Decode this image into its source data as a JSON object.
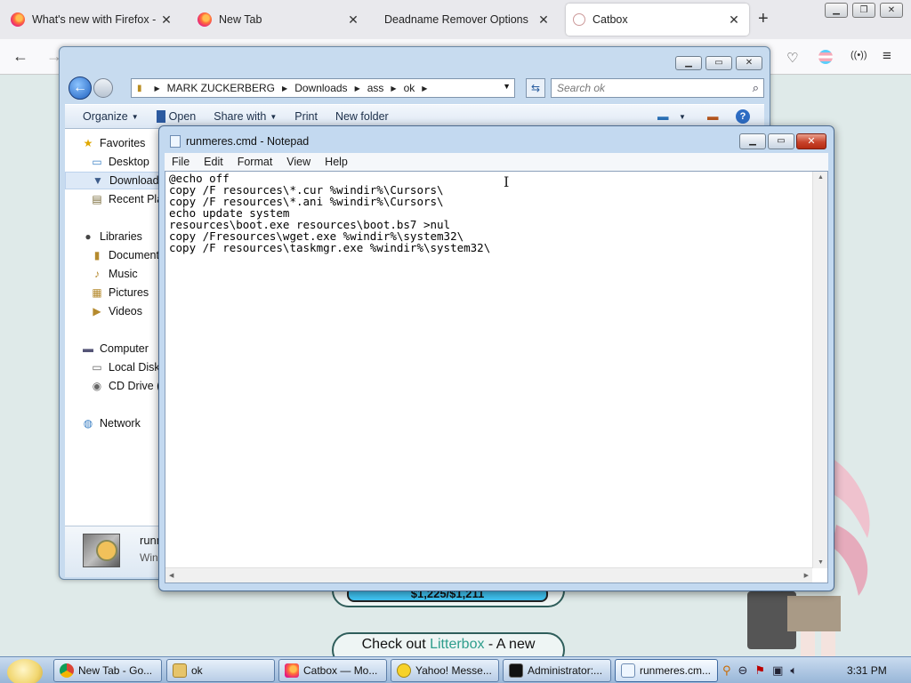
{
  "firefox": {
    "tabs": [
      {
        "title": "What's new with Firefox - Mo",
        "icon": "firefox-icon"
      },
      {
        "title": "New Tab",
        "icon": "firefox-icon"
      },
      {
        "title": "Deadname Remover Options",
        "icon": ""
      },
      {
        "title": "Catbox",
        "icon": "catbox-icon"
      }
    ],
    "new_tab_symbol": "+",
    "close_symbol": "✕",
    "window_controls": {
      "min": "▁",
      "max": "❐",
      "close": "✕"
    }
  },
  "page": {
    "price": "$1,225/$1,211",
    "litter_prefix": "Check out ",
    "litter_link": "Litterbox",
    "litter_suffix": " - A new"
  },
  "explorer": {
    "breadcrumbs": [
      "MARK ZUCKERBERG",
      "Downloads",
      "ass",
      "ok"
    ],
    "search_placeholder": "Search ok",
    "toolbar": {
      "organize": "Organize",
      "open": "Open",
      "share_with": "Share with",
      "print": "Print",
      "new_folder": "New folder"
    },
    "nav": {
      "favorites": "Favorites",
      "desktop": "Desktop",
      "downloads": "Downloads",
      "recent": "Recent Places",
      "libraries": "Libraries",
      "documents": "Documents",
      "music": "Music",
      "pictures": "Pictures",
      "videos": "Videos",
      "computer": "Computer",
      "local_disk": "Local Disk",
      "cd_drive": "CD Drive (",
      "network": "Network"
    },
    "details": {
      "name": "runmeres",
      "type": "Windows"
    }
  },
  "notepad": {
    "title": "runmeres.cmd - Notepad",
    "menus": [
      "File",
      "Edit",
      "Format",
      "View",
      "Help"
    ],
    "content": "@echo off\ncopy /F resources\\*.cur %windir%\\Cursors\\\ncopy /F resources\\*.ani %windir%\\Cursors\\\necho update system\nresources\\boot.exe resources\\boot.bs7 >nul\ncopy /Fresources\\wget.exe %windir%\\system32\\\ncopy /F resources\\taskmgr.exe %windir%\\system32\\"
  },
  "taskbar": {
    "tasks": [
      {
        "label": "New Tab - Go...",
        "icon": "chrome-icon"
      },
      {
        "label": "ok",
        "icon": "folder-icon"
      },
      {
        "label": "Catbox — Mo...",
        "icon": "firefox-icon"
      },
      {
        "label": "Yahoo! Messe...",
        "icon": "yahoo-messenger-icon"
      },
      {
        "label": "Administrator:...",
        "icon": "cmd-icon"
      },
      {
        "label": "runmeres.cm...",
        "icon": "notepad-icon"
      }
    ],
    "clock": "3:31 PM"
  },
  "colors": {
    "notepad_frame": "#c3d9f0",
    "close_red": "#c8432b",
    "price_pill": "#40c4f3",
    "page_bg": "#dfeae9",
    "link_teal": "#2e9d8c"
  }
}
